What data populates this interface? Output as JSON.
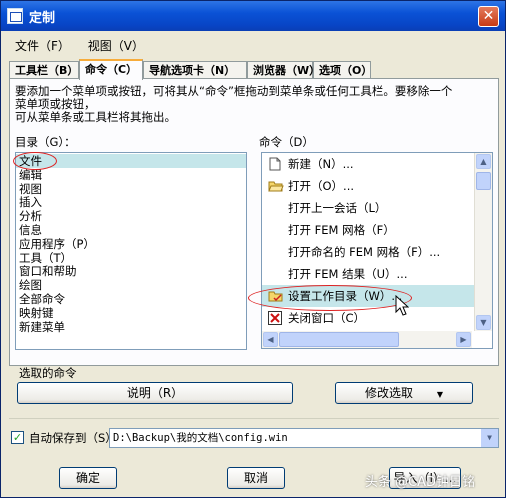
{
  "window": {
    "title": "定制"
  },
  "menubar": [
    "文件（F）",
    "视图（V）"
  ],
  "tabs": [
    {
      "label": "工具栏（B）",
      "active": false
    },
    {
      "label": "命令（C）",
      "active": true
    },
    {
      "label": "导航选项卡（N）",
      "active": false
    },
    {
      "label": "浏览器（W）",
      "active": false
    },
    {
      "label": "选项（O）",
      "active": false
    }
  ],
  "description": [
    "要添加一个菜单项或按钮，可将其从“命令”框拖动到菜单条或任何工具栏。要移除一个",
    "菜单项或按钮，",
    "可从菜单条或工具栏将其拖出。"
  ],
  "catalog": {
    "label": "目录（G）：",
    "items": [
      "文件",
      "编辑",
      "视图",
      "插入",
      "分析",
      "信息",
      "应用程序（P）",
      "工具（T）",
      "窗口和帮助",
      "绘图",
      "全部命令",
      "映射键",
      "新建菜单"
    ],
    "selected": "文件"
  },
  "commands": {
    "label": "命令（D）",
    "items": [
      {
        "label": "新建（N）...",
        "icon": "new-document-icon"
      },
      {
        "label": "打开（O）...",
        "icon": "open-folder-icon"
      },
      {
        "label": "打开上一会话（L）",
        "icon": ""
      },
      {
        "label": "打开 FEM 网格（F）",
        "icon": ""
      },
      {
        "label": "打开命名的 FEM 网格（F）...",
        "icon": ""
      },
      {
        "label": "打开 FEM 结果（U）...",
        "icon": ""
      },
      {
        "label": "设置工作目录（W）...",
        "icon": "set-working-dir-icon"
      },
      {
        "label": "关闭窗口（C）",
        "icon": "close-window-icon"
      }
    ],
    "selected": "设置工作目录（W）..."
  },
  "selected_command": {
    "label": "选取的命令",
    "description_button": "说明（R）",
    "modify_button": "修改选取"
  },
  "autosave": {
    "label": "自动保存到（S）",
    "checked": true,
    "path": "D:\\Backup\\我的文档\\config.win"
  },
  "buttons": {
    "ok": "确定",
    "cancel": "取消",
    "apply": "导入（I）..."
  },
  "watermark": "头条 @CAD钟日铭"
}
